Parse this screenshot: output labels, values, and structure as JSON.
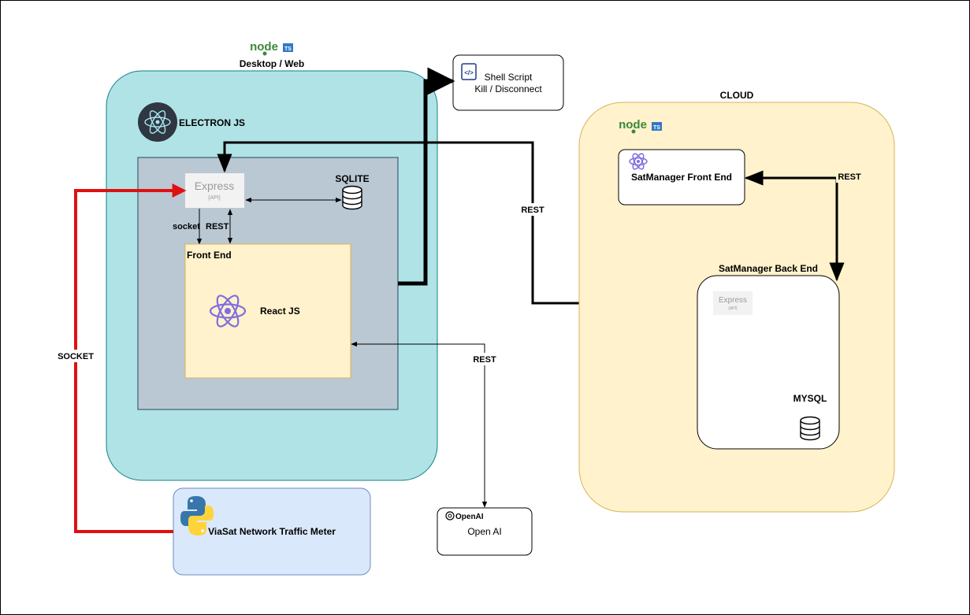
{
  "diagram": {
    "desktop": {
      "title": "Desktop / Web",
      "electron_label": "ELECTRON JS",
      "sqlite_label": "SQLITE",
      "express_label": "Express",
      "express_sub": "{API}",
      "socket_label": "socket",
      "rest_label": "REST",
      "frontend_label": "Front End",
      "react_label": "React JS"
    },
    "shell_script": {
      "line1": "Shell Script",
      "line2": "Kill / Disconnect"
    },
    "cloud": {
      "title": "CLOUD",
      "satmanager_frontend": "SatManager Front End",
      "satmanager_backend": "SatManager Back End",
      "express_label": "Express",
      "express_sub": "{API}",
      "mysql_label": "MYSQL"
    },
    "openai": {
      "logo_text": "OpenAI",
      "label": "Open AI"
    },
    "viasat": {
      "label": "ViaSat Network Traffic Meter"
    },
    "edges": {
      "socket_label": "SOCKET",
      "rest_express_to_backend": "REST",
      "rest_openai": "REST",
      "rest_cloud": "REST"
    },
    "logos": {
      "node_text": "node",
      "ts_text": "TS"
    },
    "colors": {
      "desktop_fill": "#b0e3e6",
      "desktop_stroke": "#0e8088",
      "electron_inner_fill": "#bac8d3",
      "frontend_fill": "#fff2cc",
      "frontend_stroke": "#d6b656",
      "cloud_fill": "#fff2cc",
      "cloud_stroke": "#d6b656",
      "viasat_fill": "#dae8fc",
      "viasat_stroke": "#6c8ebf",
      "socket_edge": "#e01010",
      "react_purple": "#7f6ee0",
      "electron_dark": "#2f3742",
      "node_green": "#3c873a",
      "ts_blue": "#3178c6"
    }
  }
}
